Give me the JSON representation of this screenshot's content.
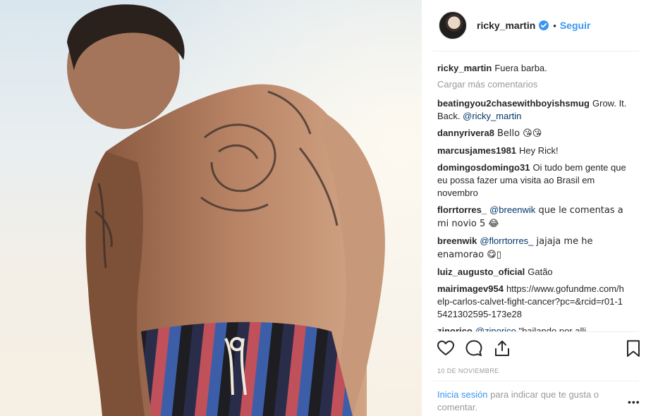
{
  "post": {
    "username": "ricky_martin",
    "follow_label": "Seguir",
    "dot": "•",
    "caption": "Fuera barba.",
    "load_more": "Cargar más comentarios",
    "date": "10 DE NOVIEMBRE",
    "more_label": "•••"
  },
  "comments": [
    {
      "user": "beatingyou2chasewithboyishsmug",
      "text": "Grow. It. Back.",
      "mention": "@ricky_martin",
      "after": ""
    },
    {
      "user": "dannyrivera8",
      "text": "Bello 😘😘",
      "mention": "",
      "after": ""
    },
    {
      "user": "marcusjames1981",
      "text": "Hey Rick!",
      "mention": "",
      "after": ""
    },
    {
      "user": "domingosdomingo31",
      "text": "Oi tudo bem gente que eu possa fazer uma visita ao Brasil em novembro",
      "mention": "",
      "after": ""
    },
    {
      "user": "florrtorres_",
      "text": "",
      "mention": "@breenwik",
      "after": " que le comentas a mi novio 5 😂"
    },
    {
      "user": "breenwik",
      "text": "",
      "mention": "@florrtorres_",
      "after": " jajaja me he enamorao 😋▯"
    },
    {
      "user": "luiz_augusto_oficial",
      "text": "Gatão",
      "mention": "",
      "after": ""
    },
    {
      "user": "mairimagev954",
      "text": "https://www.gofundme.com/help-carlos-calvet-fight-cancer?pc=&rcid=r01-15421302595-173e28",
      "mention": "",
      "after": ""
    },
    {
      "user": "zinorico",
      "text": "",
      "mention": "@zinorico",
      "after": " \"bailando por alli,"
    }
  ],
  "login": {
    "link": "Inicia sesión",
    "rest": " para indicar que te gusta o comentar."
  },
  "icons": {
    "like": "heart-icon",
    "comment": "comment-icon",
    "share": "share-icon",
    "save": "bookmark-icon",
    "verified": "verified-badge-icon"
  },
  "colors": {
    "link": "#3897f0",
    "mention": "#003569",
    "muted": "#999999",
    "text": "#262626"
  }
}
